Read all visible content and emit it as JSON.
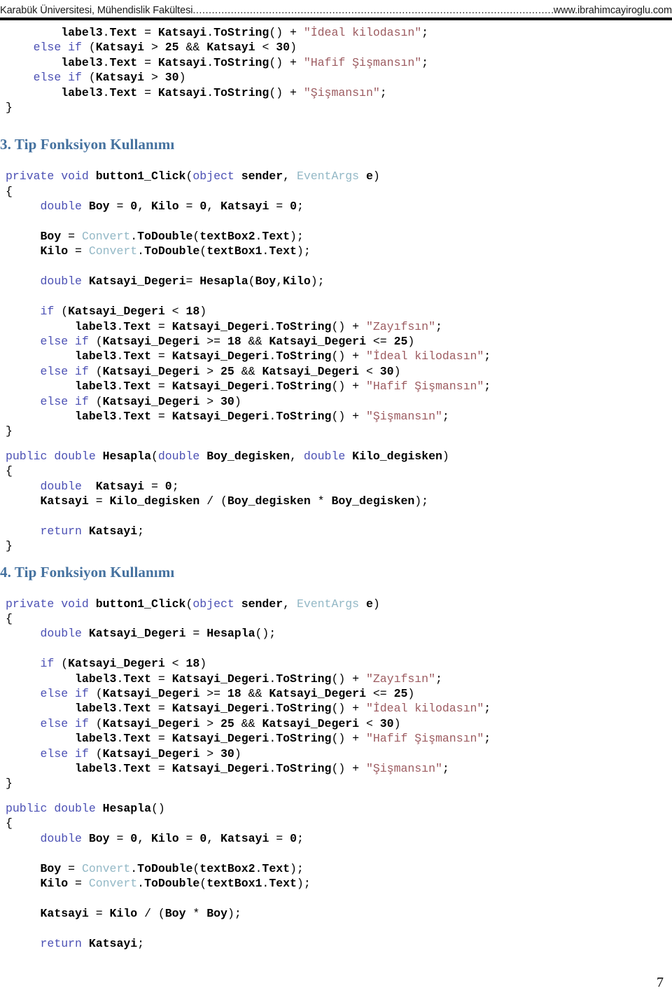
{
  "header": {
    "left": "Karabük Üniversitesi, Mühendislik Fakültesi",
    "dots": "..................................................................................................................",
    "right": "www.ibrahimcayiroglu.com"
  },
  "page_number": "7",
  "sections": {
    "top_code_fragment": {
      "lines": [
        "        label3.Text = Katsayi.ToString() + \"İdeal kilodasın\";",
        "    else if (Katsayi > 25 && Katsayi < 30)",
        "        label3.Text = Katsayi.ToString() + \"Hafif Şişmansın\";",
        "    else if (Katsayi > 30)",
        "        label3.Text = Katsayi.ToString() + \"Şişmansın\";",
        "}"
      ]
    },
    "heading3": "3. Tip Fonksiyon Kullanımı",
    "code3_part1": {
      "lines": [
        "private void button1_Click(object sender, EventArgs e)",
        "{",
        "     double Boy = 0, Kilo = 0, Katsayi = 0;",
        "",
        "     Boy = Convert.ToDouble(textBox2.Text);",
        "     Kilo = Convert.ToDouble(textBox1.Text);",
        "",
        "     double Katsayi_Degeri= Hesapla(Boy,Kilo);",
        "",
        "     if (Katsayi_Degeri < 18)",
        "          label3.Text = Katsayi_Degeri.ToString() + \"Zayıfsın\";",
        "     else if (Katsayi_Degeri >= 18 && Katsayi_Degeri <= 25)",
        "          label3.Text = Katsayi_Degeri.ToString() + \"İdeal kilodasın\";",
        "     else if (Katsayi_Degeri > 25 && Katsayi_Degeri < 30)",
        "          label3.Text = Katsayi_Degeri.ToString() + \"Hafif Şişmansın\";",
        "     else if (Katsayi_Degeri > 30)",
        "          label3.Text = Katsayi_Degeri.ToString() + \"Şişmansın\";",
        "}"
      ]
    },
    "code3_part2": {
      "lines": [
        "public double Hesapla(double Boy_degisken, double Kilo_degisken)",
        "{",
        "     double  Katsayi = 0;",
        "     Katsayi = Kilo_degisken / (Boy_degisken * Boy_degisken);",
        "",
        "     return Katsayi;",
        "}"
      ]
    },
    "heading4": "4. Tip Fonksiyon Kullanımı",
    "code4_part1": {
      "lines": [
        "private void button1_Click(object sender, EventArgs e)",
        "{",
        "     double Katsayi_Degeri = Hesapla();",
        "",
        "     if (Katsayi_Degeri < 18)",
        "          label3.Text = Katsayi_Degeri.ToString() + \"Zayıfsın\";",
        "     else if (Katsayi_Degeri >= 18 && Katsayi_Degeri <= 25)",
        "          label3.Text = Katsayi_Degeri.ToString() + \"İdeal kilodasın\";",
        "     else if (Katsayi_Degeri > 25 && Katsayi_Degeri < 30)",
        "          label3.Text = Katsayi_Degeri.ToString() + \"Hafif Şişmansın\";",
        "     else if (Katsayi_Degeri > 30)",
        "          label3.Text = Katsayi_Degeri.ToString() + \"Şişmansın\";",
        "}"
      ]
    },
    "code4_part2": {
      "lines": [
        "public double Hesapla()",
        "{",
        "     double Boy = 0, Kilo = 0, Katsayi = 0;",
        "",
        "     Boy = Convert.ToDouble(textBox2.Text);",
        "     Kilo = Convert.ToDouble(textBox1.Text);",
        "",
        "     Katsayi = Kilo / (Boy * Boy);",
        "",
        "     return Katsayi;"
      ]
    }
  },
  "colors": {
    "keyword": "#4b50b4",
    "type": "#93b8c6",
    "string": "#9c5b60",
    "heading": "#44719f",
    "text": "#000000"
  }
}
